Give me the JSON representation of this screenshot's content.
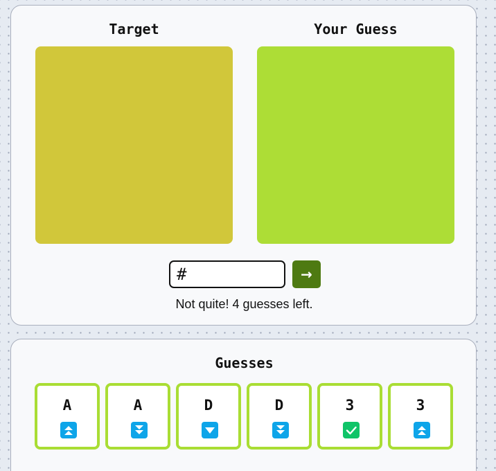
{
  "panel": {
    "target_heading": "Target",
    "guess_heading": "Your Guess",
    "target_color": "#d1c73a",
    "guess_color": "#addd36",
    "input_value": "#",
    "submit_icon": "arrow-right-icon",
    "submit_glyph": "→",
    "status": "Not quite! 4 guesses left."
  },
  "history": {
    "heading": "Guesses",
    "tile_border_color": "#a9dd34",
    "tiles": [
      {
        "char": "A",
        "hint": "double-up",
        "icon": "double-up-arrow-icon",
        "color": "#0ea5e9"
      },
      {
        "char": "A",
        "hint": "double-down",
        "icon": "double-down-arrow-icon",
        "color": "#0ea5e9"
      },
      {
        "char": "D",
        "hint": "down",
        "icon": "down-arrow-icon",
        "color": "#0ea5e9"
      },
      {
        "char": "D",
        "hint": "double-down",
        "icon": "double-down-arrow-icon",
        "color": "#0ea5e9"
      },
      {
        "char": "3",
        "hint": "correct",
        "icon": "check-icon",
        "color": "#10c468"
      },
      {
        "char": "3",
        "hint": "double-up",
        "icon": "double-up-arrow-icon",
        "color": "#0ea5e9"
      }
    ]
  }
}
